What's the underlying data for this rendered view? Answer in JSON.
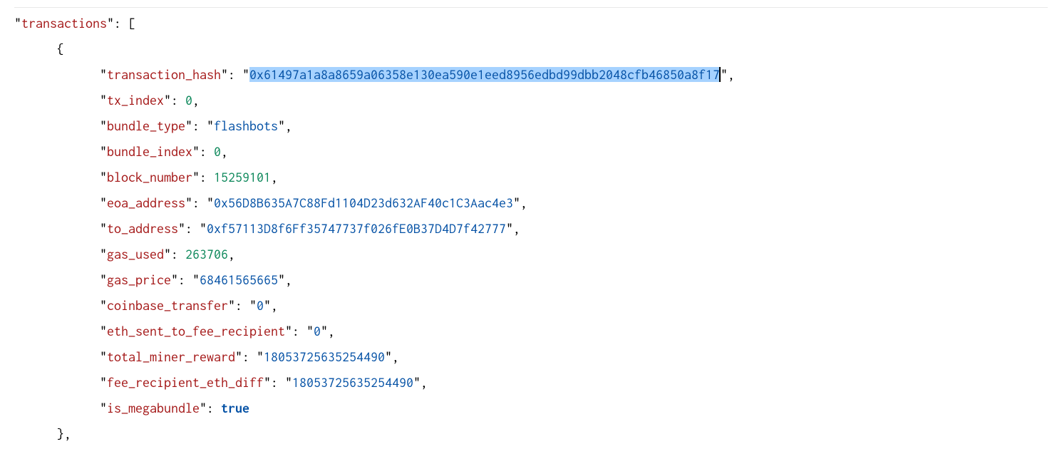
{
  "json": {
    "array_key": "transactions",
    "transaction_hash": {
      "key": "transaction_hash",
      "value": "0x61497a1a8a8659a06358e130ea590e1eed8956edbd99dbb2048cfb46850a8f17"
    },
    "tx_index": {
      "key": "tx_index",
      "value": 0
    },
    "bundle_type": {
      "key": "bundle_type",
      "value": "flashbots"
    },
    "bundle_index": {
      "key": "bundle_index",
      "value": 0
    },
    "block_number": {
      "key": "block_number",
      "value": 15259101
    },
    "eoa_address": {
      "key": "eoa_address",
      "value": "0x56D8B635A7C88Fd1104D23d632AF40c1C3Aac4e3"
    },
    "to_address": {
      "key": "to_address",
      "value": "0xf57113D8f6Ff35747737f026fE0B37D4D7f42777"
    },
    "gas_used": {
      "key": "gas_used",
      "value": 263706
    },
    "gas_price": {
      "key": "gas_price",
      "value": "68461565665"
    },
    "coinbase_transfer": {
      "key": "coinbase_transfer",
      "value": "0"
    },
    "eth_sent_to_fee_recipient": {
      "key": "eth_sent_to_fee_recipient",
      "value": "0"
    },
    "total_miner_reward": {
      "key": "total_miner_reward",
      "value": "18053725635254490"
    },
    "fee_recipient_eth_diff": {
      "key": "fee_recipient_eth_diff",
      "value": "18053725635254490"
    },
    "is_megabundle": {
      "key": "is_megabundle",
      "value": "true"
    }
  }
}
